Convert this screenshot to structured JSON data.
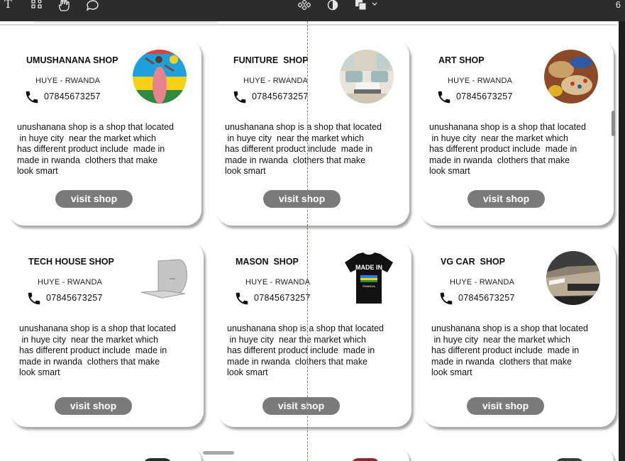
{
  "toolbar": {
    "text_tool_glyph": "T",
    "right_indicator": "6"
  },
  "icons": [
    "text-tool-icon",
    "shape-tool-icon",
    "hand-tool-icon",
    "comment-icon",
    "components-icon",
    "contrast-icon",
    "boolean-icon",
    "chevron-down-icon",
    "phone-icon"
  ],
  "colors": {
    "button_bg": "#7a7a7a",
    "guide": "#3a8fd6",
    "toolbar_bg": "#2c2c2c"
  },
  "cards": [
    {
      "title": "UMUSHANANA SHOP",
      "location": "HUYE - RWANDA",
      "phone": "07845673257",
      "description": "unushanana shop is a shop that located\n in huye city  near the market which\nhas different product include  made in\nmade in rwanda  clothers that make\nlook smart",
      "button": "visit shop",
      "image": "woman-with-rwanda-flag"
    },
    {
      "title": "FUNITURE  SHOP",
      "location": "HUYE - RWANDA",
      "phone": "07845673257",
      "description": "unushanana shop is a shop that located\n in huye city  near the market which\nhas different product include  made in\nmade in rwanda  clothers that make\nlook smart",
      "button": "visit shop",
      "image": "living-room-furniture"
    },
    {
      "title": "ART SHOP",
      "location": "HUYE - RWANDA",
      "phone": "07845673257",
      "description": "unushanana shop is a shop that located\n in huye city  near the market which\nhas different product include  made in\nmade in rwanda  clothers that make\nlook smart",
      "button": "visit shop",
      "image": "art-crafts"
    },
    {
      "title": "TECH HOUSE SHOP",
      "location": "HUYE - RWANDA",
      "phone": "07845673257",
      "description": "unushanana shop is a shop that located\n in huye city  near the market which\nhas different product include  made in\nmade in rwanda  clothers that make\nlook smart",
      "button": "visit shop",
      "image": "laptop"
    },
    {
      "title": "MASON  SHOP",
      "location": "HUYE - RWANDA",
      "phone": "07845673257",
      "description": "unushanana shop is a shop that located\n in huye city  near the market which\nhas different product include  made in\nmade in rwanda  clothers that make\nlook smart",
      "button": "visit shop",
      "image": "made-in-rwanda-tshirt"
    },
    {
      "title": "VG CAR  SHOP",
      "location": "HUYE - RWANDA",
      "phone": "07845673257",
      "description": "unushanana shop is a shop that located\n in huye city  near the market which\nhas different product include  made in\nmade in rwanda  clothers that make\nlook smart",
      "button": "visit shop",
      "image": "car"
    }
  ],
  "tshirt_text": "MADE IN",
  "tshirt_subtext": "RWANDA"
}
